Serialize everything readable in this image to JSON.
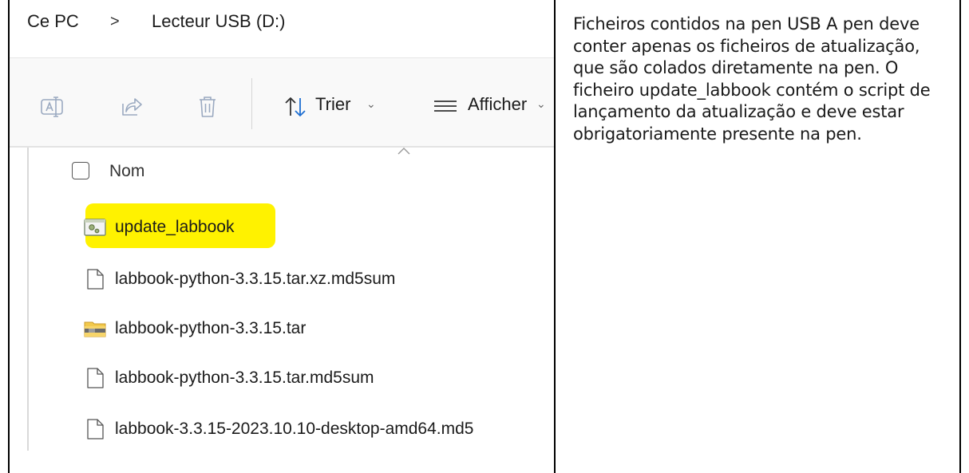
{
  "breadcrumb": {
    "root": "Ce PC",
    "separator": ">",
    "drive": "Lecteur USB (D:)"
  },
  "toolbar": {
    "sort_label": "Trier",
    "view_label": "Afficher",
    "icons": [
      "rename-icon",
      "share-icon",
      "delete-icon",
      "sort-icon",
      "view-icon"
    ]
  },
  "file_list": {
    "column_header": "Nom",
    "files": [
      {
        "name": "update_labbook",
        "type": "script",
        "highlighted": true
      },
      {
        "name": "labbook-python-3.3.15.tar.xz.md5sum",
        "type": "file"
      },
      {
        "name": "labbook-python-3.3.15.tar",
        "type": "archive"
      },
      {
        "name": "labbook-python-3.3.15.tar.md5sum",
        "type": "file"
      },
      {
        "name": "labbook-3.3.15-2023.10.10-desktop-amd64.md5",
        "type": "file"
      }
    ]
  },
  "description": {
    "text": "Ficheiros contidos na pen USB A pen deve conter apenas os ficheiros de atualização, que são colados diretamente na pen. O ficheiro update_labbook contém o script de lançamento da atualização e deve estar obrigatoriamente presente na pen."
  },
  "colors": {
    "highlight": "#fff200",
    "toolbar_bg": "#f9f9f9",
    "archive_folder": "#f2c94c"
  }
}
